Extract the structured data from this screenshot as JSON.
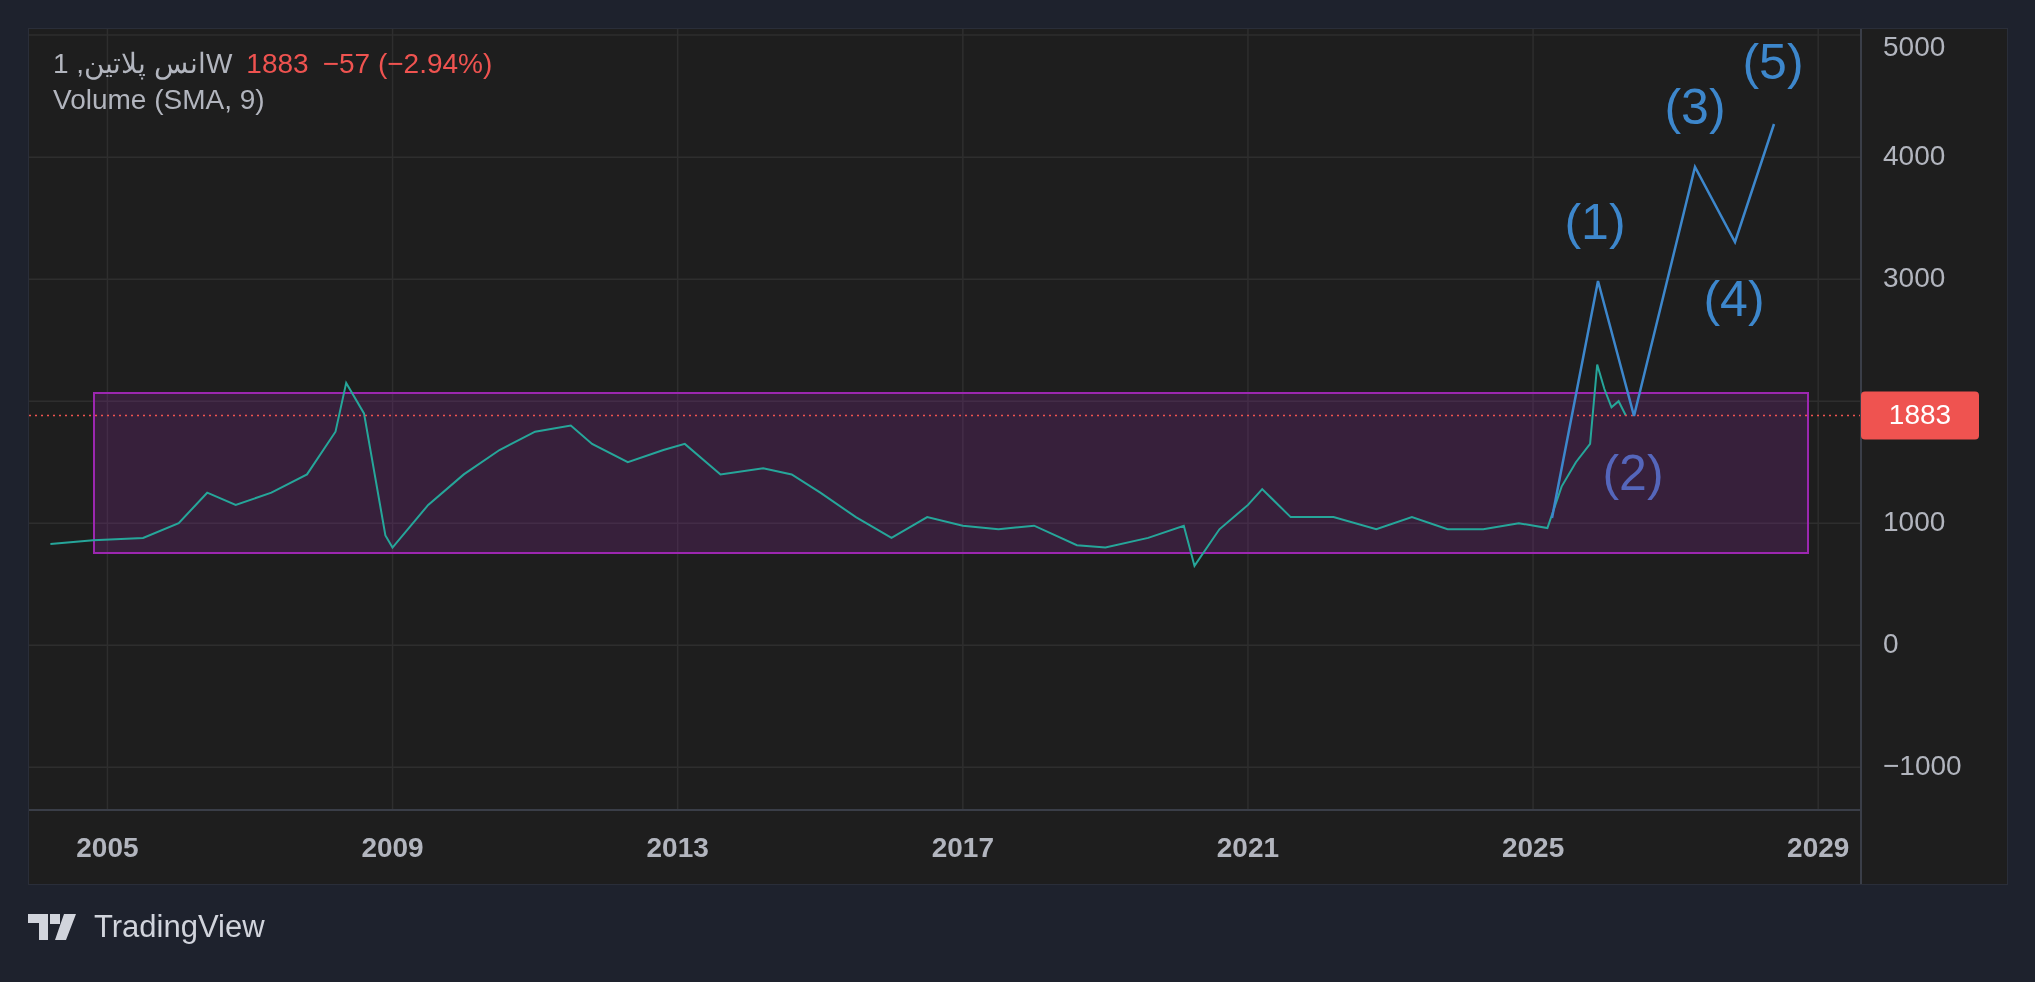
{
  "legend": {
    "symbol": "انس پلاتین, 1W",
    "last": "1883",
    "change": "−57 (−2.94%)",
    "indicator": "Volume (SMA, 9)"
  },
  "chart": {
    "chart_data": {
      "type": "line",
      "x": [
        2004.2,
        2004.8,
        2005.5,
        2006.0,
        2006.4,
        2006.8,
        2007.3,
        2007.8,
        2008.2,
        2008.35,
        2008.6,
        2008.9,
        2009.0,
        2009.5,
        2010.0,
        2010.5,
        2011.0,
        2011.5,
        2011.8,
        2012.3,
        2012.8,
        2013.1,
        2013.6,
        2014.2,
        2014.6,
        2015.0,
        2015.5,
        2016.0,
        2016.5,
        2017.0,
        2017.5,
        2018.0,
        2018.6,
        2019.0,
        2019.6,
        2020.1,
        2020.25,
        2020.6,
        2021.0,
        2021.2,
        2021.6,
        2022.2,
        2022.8,
        2023.3,
        2023.8,
        2024.3,
        2024.8,
        2025.2,
        2025.4,
        2025.6,
        2025.8,
        2025.9,
        2026.0,
        2026.1,
        2026.2,
        2026.3
      ],
      "series": [
        {
          "color": "#26a69a",
          "values": [
            830,
            860,
            880,
            1000,
            1250,
            1150,
            1250,
            1400,
            1750,
            2150,
            1900,
            900,
            800,
            1150,
            1400,
            1600,
            1750,
            1800,
            1650,
            1500,
            1600,
            1650,
            1400,
            1450,
            1400,
            1250,
            1050,
            880,
            1050,
            980,
            950,
            980,
            820,
            800,
            880,
            980,
            650,
            950,
            1150,
            1280,
            1050,
            1050,
            950,
            1050,
            950,
            950,
            1000,
            960,
            1300,
            1500,
            1650,
            2300,
            2100,
            1950,
            2000,
            1883
          ]
        }
      ],
      "xlim": [
        2003.9,
        2029.6
      ],
      "ylim": [
        -1350,
        5050
      ],
      "grid": true,
      "ref_lines": [
        {
          "axis": "y",
          "value": 1883,
          "label": "1883",
          "color": "#ef5350"
        }
      ],
      "xticks": [
        2005,
        2009,
        2013,
        2017,
        2021,
        2025,
        2029
      ],
      "yticks": [
        -1000,
        0,
        1000,
        3000,
        4000,
        5000
      ]
    },
    "wave_labels": [
      {
        "text": "(1)",
        "color": "#3d87cc"
      },
      {
        "text": "(2)",
        "color": "#5566bb"
      },
      {
        "text": "(3)",
        "color": "#3d87cc"
      },
      {
        "text": "(4)",
        "color": "#3d87cc"
      },
      {
        "text": "(5)",
        "color": "#3d87cc"
      }
    ]
  },
  "footer": {
    "brand": "TradingView"
  }
}
